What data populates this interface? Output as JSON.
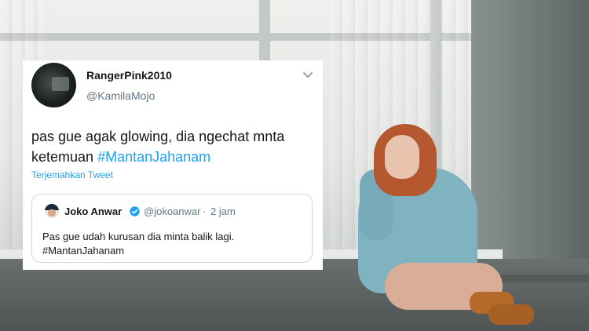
{
  "tweet": {
    "display_name": "RangerPink2010",
    "handle": "@KamilaMojo",
    "text": "pas gue agak glowing, dia ngechat mnta ketemuan ",
    "hashtag": "#MantanJahanam",
    "translate_label": "Terjemahkan Tweet",
    "menu_icon": "chevron-down-icon"
  },
  "quoted_tweet": {
    "display_name": "Joko Anwar",
    "verified_icon": "verified-badge-icon",
    "handle": "@jokoanwar",
    "separator": "·",
    "time": "2 jam",
    "line1": "Pas gue udah kurusan dia minta balik lagi.",
    "line2": "#MantanJahanam"
  },
  "colors": {
    "link": "#1da1f2",
    "text": "#14171a",
    "secondary": "#657786"
  }
}
